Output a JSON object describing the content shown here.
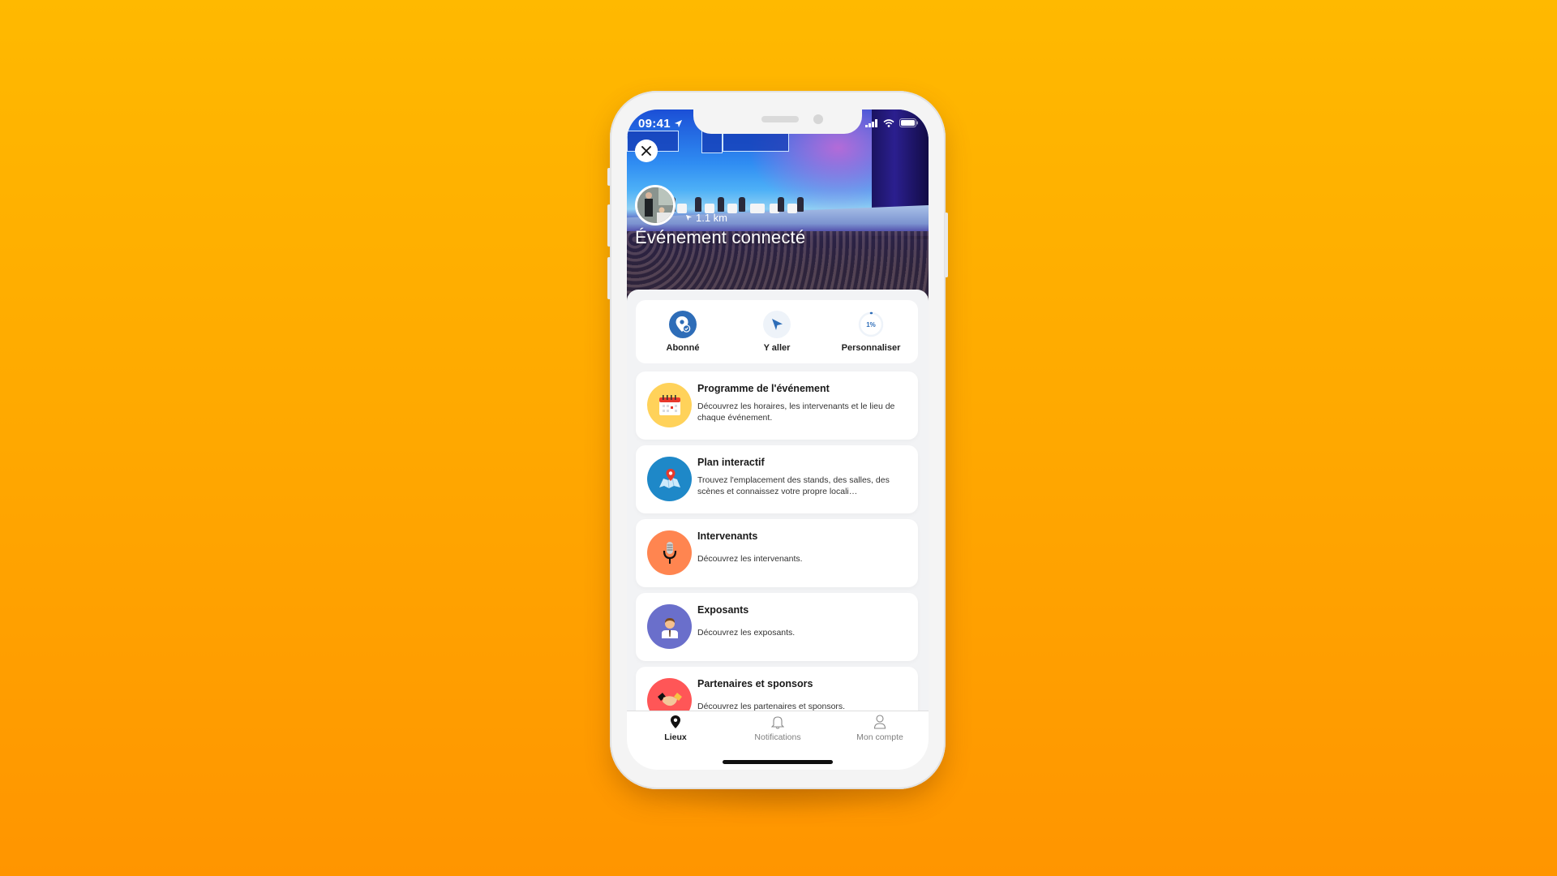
{
  "status_bar": {
    "time": "09:41"
  },
  "hero": {
    "title": "Événement connecté",
    "distance": "1.1 km"
  },
  "actions": [
    {
      "label": "Abonné",
      "icon": "pin-check-icon"
    },
    {
      "label": "Y aller",
      "icon": "navigate-arrow-icon"
    },
    {
      "label": "Personnaliser",
      "icon": "progress-ring-icon",
      "value": "1%",
      "progress_percent": 1
    }
  ],
  "cards": [
    {
      "title": "Programme de l'événement",
      "description": "Découvrez les horaires, les intervenants et le lieu de chaque événement.",
      "icon": "calendar-icon",
      "color": "#FFD25A"
    },
    {
      "title": "Plan interactif",
      "description": "Trouvez l'emplacement des stands, des salles, des scènes et connaissez votre propre locali…",
      "icon": "map-pin-icon",
      "color": "#1E88C8"
    },
    {
      "title": "Intervenants",
      "description": "Découvrez les intervenants.",
      "icon": "microphone-icon",
      "color": "#FF8550"
    },
    {
      "title": "Exposants",
      "description": "Découvrez les exposants.",
      "icon": "person-icon",
      "color": "#6A6FCB"
    },
    {
      "title": "Partenaires et sponsors",
      "description": "Découvrez les partenaires et sponsors.",
      "icon": "handshake-icon",
      "color": "#FF5657"
    }
  ],
  "bottom_nav": [
    {
      "label": "Lieux",
      "icon": "location-pin-icon",
      "active": true
    },
    {
      "label": "Notifications",
      "icon": "bell-icon",
      "active": false
    },
    {
      "label": "Mon compte",
      "icon": "user-icon",
      "active": false
    }
  ],
  "colors": {
    "background_top": "#FFB900",
    "background_bottom": "#FF9500",
    "accent_blue": "#2E6DB8"
  }
}
